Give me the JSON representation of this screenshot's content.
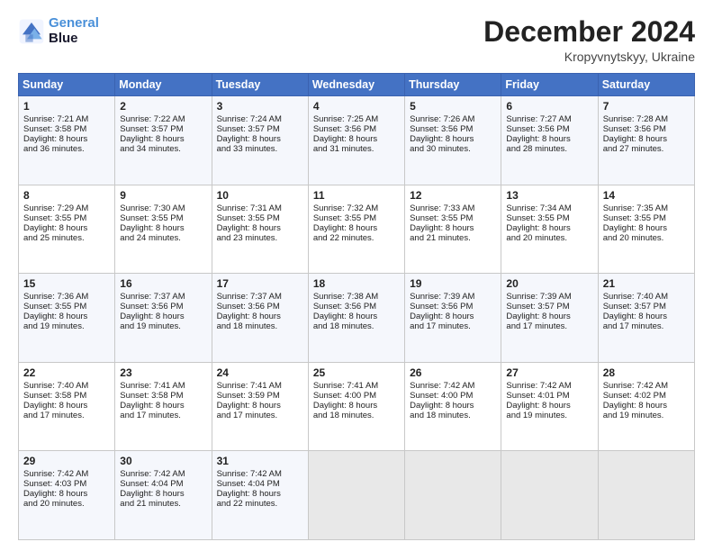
{
  "header": {
    "logo_line1": "General",
    "logo_line2": "Blue",
    "month_title": "December 2024",
    "location": "Kropyvnytskyy, Ukraine"
  },
  "weekdays": [
    "Sunday",
    "Monday",
    "Tuesday",
    "Wednesday",
    "Thursday",
    "Friday",
    "Saturday"
  ],
  "weeks": [
    [
      {
        "day": "1",
        "lines": [
          "Sunrise: 7:21 AM",
          "Sunset: 3:58 PM",
          "Daylight: 8 hours",
          "and 36 minutes."
        ]
      },
      {
        "day": "2",
        "lines": [
          "Sunrise: 7:22 AM",
          "Sunset: 3:57 PM",
          "Daylight: 8 hours",
          "and 34 minutes."
        ]
      },
      {
        "day": "3",
        "lines": [
          "Sunrise: 7:24 AM",
          "Sunset: 3:57 PM",
          "Daylight: 8 hours",
          "and 33 minutes."
        ]
      },
      {
        "day": "4",
        "lines": [
          "Sunrise: 7:25 AM",
          "Sunset: 3:56 PM",
          "Daylight: 8 hours",
          "and 31 minutes."
        ]
      },
      {
        "day": "5",
        "lines": [
          "Sunrise: 7:26 AM",
          "Sunset: 3:56 PM",
          "Daylight: 8 hours",
          "and 30 minutes."
        ]
      },
      {
        "day": "6",
        "lines": [
          "Sunrise: 7:27 AM",
          "Sunset: 3:56 PM",
          "Daylight: 8 hours",
          "and 28 minutes."
        ]
      },
      {
        "day": "7",
        "lines": [
          "Sunrise: 7:28 AM",
          "Sunset: 3:56 PM",
          "Daylight: 8 hours",
          "and 27 minutes."
        ]
      }
    ],
    [
      {
        "day": "8",
        "lines": [
          "Sunrise: 7:29 AM",
          "Sunset: 3:55 PM",
          "Daylight: 8 hours",
          "and 25 minutes."
        ]
      },
      {
        "day": "9",
        "lines": [
          "Sunrise: 7:30 AM",
          "Sunset: 3:55 PM",
          "Daylight: 8 hours",
          "and 24 minutes."
        ]
      },
      {
        "day": "10",
        "lines": [
          "Sunrise: 7:31 AM",
          "Sunset: 3:55 PM",
          "Daylight: 8 hours",
          "and 23 minutes."
        ]
      },
      {
        "day": "11",
        "lines": [
          "Sunrise: 7:32 AM",
          "Sunset: 3:55 PM",
          "Daylight: 8 hours",
          "and 22 minutes."
        ]
      },
      {
        "day": "12",
        "lines": [
          "Sunrise: 7:33 AM",
          "Sunset: 3:55 PM",
          "Daylight: 8 hours",
          "and 21 minutes."
        ]
      },
      {
        "day": "13",
        "lines": [
          "Sunrise: 7:34 AM",
          "Sunset: 3:55 PM",
          "Daylight: 8 hours",
          "and 20 minutes."
        ]
      },
      {
        "day": "14",
        "lines": [
          "Sunrise: 7:35 AM",
          "Sunset: 3:55 PM",
          "Daylight: 8 hours",
          "and 20 minutes."
        ]
      }
    ],
    [
      {
        "day": "15",
        "lines": [
          "Sunrise: 7:36 AM",
          "Sunset: 3:55 PM",
          "Daylight: 8 hours",
          "and 19 minutes."
        ]
      },
      {
        "day": "16",
        "lines": [
          "Sunrise: 7:37 AM",
          "Sunset: 3:56 PM",
          "Daylight: 8 hours",
          "and 19 minutes."
        ]
      },
      {
        "day": "17",
        "lines": [
          "Sunrise: 7:37 AM",
          "Sunset: 3:56 PM",
          "Daylight: 8 hours",
          "and 18 minutes."
        ]
      },
      {
        "day": "18",
        "lines": [
          "Sunrise: 7:38 AM",
          "Sunset: 3:56 PM",
          "Daylight: 8 hours",
          "and 18 minutes."
        ]
      },
      {
        "day": "19",
        "lines": [
          "Sunrise: 7:39 AM",
          "Sunset: 3:56 PM",
          "Daylight: 8 hours",
          "and 17 minutes."
        ]
      },
      {
        "day": "20",
        "lines": [
          "Sunrise: 7:39 AM",
          "Sunset: 3:57 PM",
          "Daylight: 8 hours",
          "and 17 minutes."
        ]
      },
      {
        "day": "21",
        "lines": [
          "Sunrise: 7:40 AM",
          "Sunset: 3:57 PM",
          "Daylight: 8 hours",
          "and 17 minutes."
        ]
      }
    ],
    [
      {
        "day": "22",
        "lines": [
          "Sunrise: 7:40 AM",
          "Sunset: 3:58 PM",
          "Daylight: 8 hours",
          "and 17 minutes."
        ]
      },
      {
        "day": "23",
        "lines": [
          "Sunrise: 7:41 AM",
          "Sunset: 3:58 PM",
          "Daylight: 8 hours",
          "and 17 minutes."
        ]
      },
      {
        "day": "24",
        "lines": [
          "Sunrise: 7:41 AM",
          "Sunset: 3:59 PM",
          "Daylight: 8 hours",
          "and 17 minutes."
        ]
      },
      {
        "day": "25",
        "lines": [
          "Sunrise: 7:41 AM",
          "Sunset: 4:00 PM",
          "Daylight: 8 hours",
          "and 18 minutes."
        ]
      },
      {
        "day": "26",
        "lines": [
          "Sunrise: 7:42 AM",
          "Sunset: 4:00 PM",
          "Daylight: 8 hours",
          "and 18 minutes."
        ]
      },
      {
        "day": "27",
        "lines": [
          "Sunrise: 7:42 AM",
          "Sunset: 4:01 PM",
          "Daylight: 8 hours",
          "and 19 minutes."
        ]
      },
      {
        "day": "28",
        "lines": [
          "Sunrise: 7:42 AM",
          "Sunset: 4:02 PM",
          "Daylight: 8 hours",
          "and 19 minutes."
        ]
      }
    ],
    [
      {
        "day": "29",
        "lines": [
          "Sunrise: 7:42 AM",
          "Sunset: 4:03 PM",
          "Daylight: 8 hours",
          "and 20 minutes."
        ]
      },
      {
        "day": "30",
        "lines": [
          "Sunrise: 7:42 AM",
          "Sunset: 4:04 PM",
          "Daylight: 8 hours",
          "and 21 minutes."
        ]
      },
      {
        "day": "31",
        "lines": [
          "Sunrise: 7:42 AM",
          "Sunset: 4:04 PM",
          "Daylight: 8 hours",
          "and 22 minutes."
        ]
      },
      {
        "day": "",
        "lines": []
      },
      {
        "day": "",
        "lines": []
      },
      {
        "day": "",
        "lines": []
      },
      {
        "day": "",
        "lines": []
      }
    ]
  ]
}
